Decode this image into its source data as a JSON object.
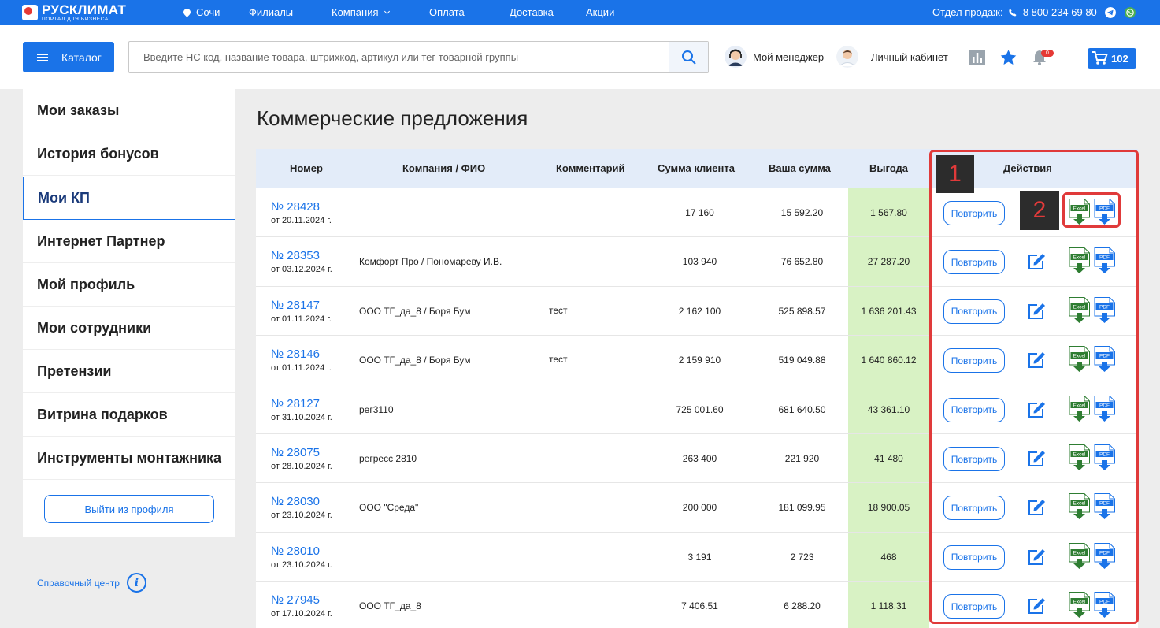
{
  "topbar": {
    "logo_name": "РУСКЛИМАТ",
    "logo_sub": "ПОРТАЛ ДЛЯ БИЗНЕСА",
    "city": "Сочи",
    "nav": [
      "Филиалы",
      "Компания",
      "Оплата",
      "Доставка",
      "Акции"
    ],
    "sales_label": "Отдел продаж:",
    "phone": "8 800 234 69 80"
  },
  "header": {
    "catalog_label": "Каталог",
    "search_placeholder": "Введите НС код, название товара, штрихкод, артикул или тег товарной группы",
    "manager_label": "Мой менеджер",
    "account_label": "Личный кабинет",
    "notifications_count": "0",
    "cart_count": "102"
  },
  "sidebar": {
    "items": [
      "Мои заказы",
      "История бонусов",
      "Мои КП",
      "Интернет Партнер",
      "Мой профиль",
      "Мои сотрудники",
      "Претензии",
      "Витрина подарков",
      "Инструменты монтажника"
    ],
    "active_index": 2,
    "logout_label": "Выйти из профиля",
    "help_label": "Справочный центр"
  },
  "main": {
    "title": "Коммерческие предложения",
    "columns": [
      "Номер",
      "Компания / ФИО",
      "Комментарий",
      "Сумма клиента",
      "Ваша сумма",
      "Выгода",
      "Действия"
    ],
    "repeat_label": "Повторить",
    "rows": [
      {
        "number": "№ 28428",
        "date": "от 20.11.2024 г.",
        "company": "",
        "comment": "",
        "client_sum": "17 160",
        "our_sum": "15 592.20",
        "profit": "1 567.80"
      },
      {
        "number": "№ 28353",
        "date": "от 03.12.2024 г.",
        "company": "Комфорт Про / Пономареву И.В.",
        "comment": "",
        "client_sum": "103 940",
        "our_sum": "76 652.80",
        "profit": "27 287.20"
      },
      {
        "number": "№ 28147",
        "date": "от 01.11.2024 г.",
        "company": "ООО ТГ_да_8 / Боря Бум",
        "comment": "тест",
        "client_sum": "2 162 100",
        "our_sum": "525 898.57",
        "profit": "1 636 201.43"
      },
      {
        "number": "№ 28146",
        "date": "от 01.11.2024 г.",
        "company": "ООО ТГ_да_8 / Боря Бум",
        "comment": "тест",
        "client_sum": "2 159 910",
        "our_sum": "519 049.88",
        "profit": "1 640 860.12"
      },
      {
        "number": "№ 28127",
        "date": "от 31.10.2024 г.",
        "company": "рег3110",
        "comment": "",
        "client_sum": "725 001.60",
        "our_sum": "681 640.50",
        "profit": "43 361.10"
      },
      {
        "number": "№ 28075",
        "date": "от 28.10.2024 г.",
        "company": "регресс 2810",
        "comment": "",
        "client_sum": "263 400",
        "our_sum": "221 920",
        "profit": "41 480"
      },
      {
        "number": "№ 28030",
        "date": "от 23.10.2024 г.",
        "company": "ООО \"Среда\"",
        "comment": "",
        "client_sum": "200 000",
        "our_sum": "181 099.95",
        "profit": "18 900.05"
      },
      {
        "number": "№ 28010",
        "date": "от 23.10.2024 г.",
        "company": "",
        "comment": "",
        "client_sum": "3 191",
        "our_sum": "2 723",
        "profit": "468"
      },
      {
        "number": "№ 27945",
        "date": "от 17.10.2024 г.",
        "company": "ООО ТГ_да_8",
        "comment": "",
        "client_sum": "7 406.51",
        "our_sum": "6 288.20",
        "profit": "1 118.31"
      }
    ],
    "excel_label": "Excel",
    "pdf_label": "PDF"
  },
  "annotations": {
    "marker_1": "1",
    "marker_2": "2"
  },
  "colors": {
    "brand": "#1a73e8",
    "profit_bg": "#d8f2c4",
    "annotation": "#e03a3a"
  }
}
